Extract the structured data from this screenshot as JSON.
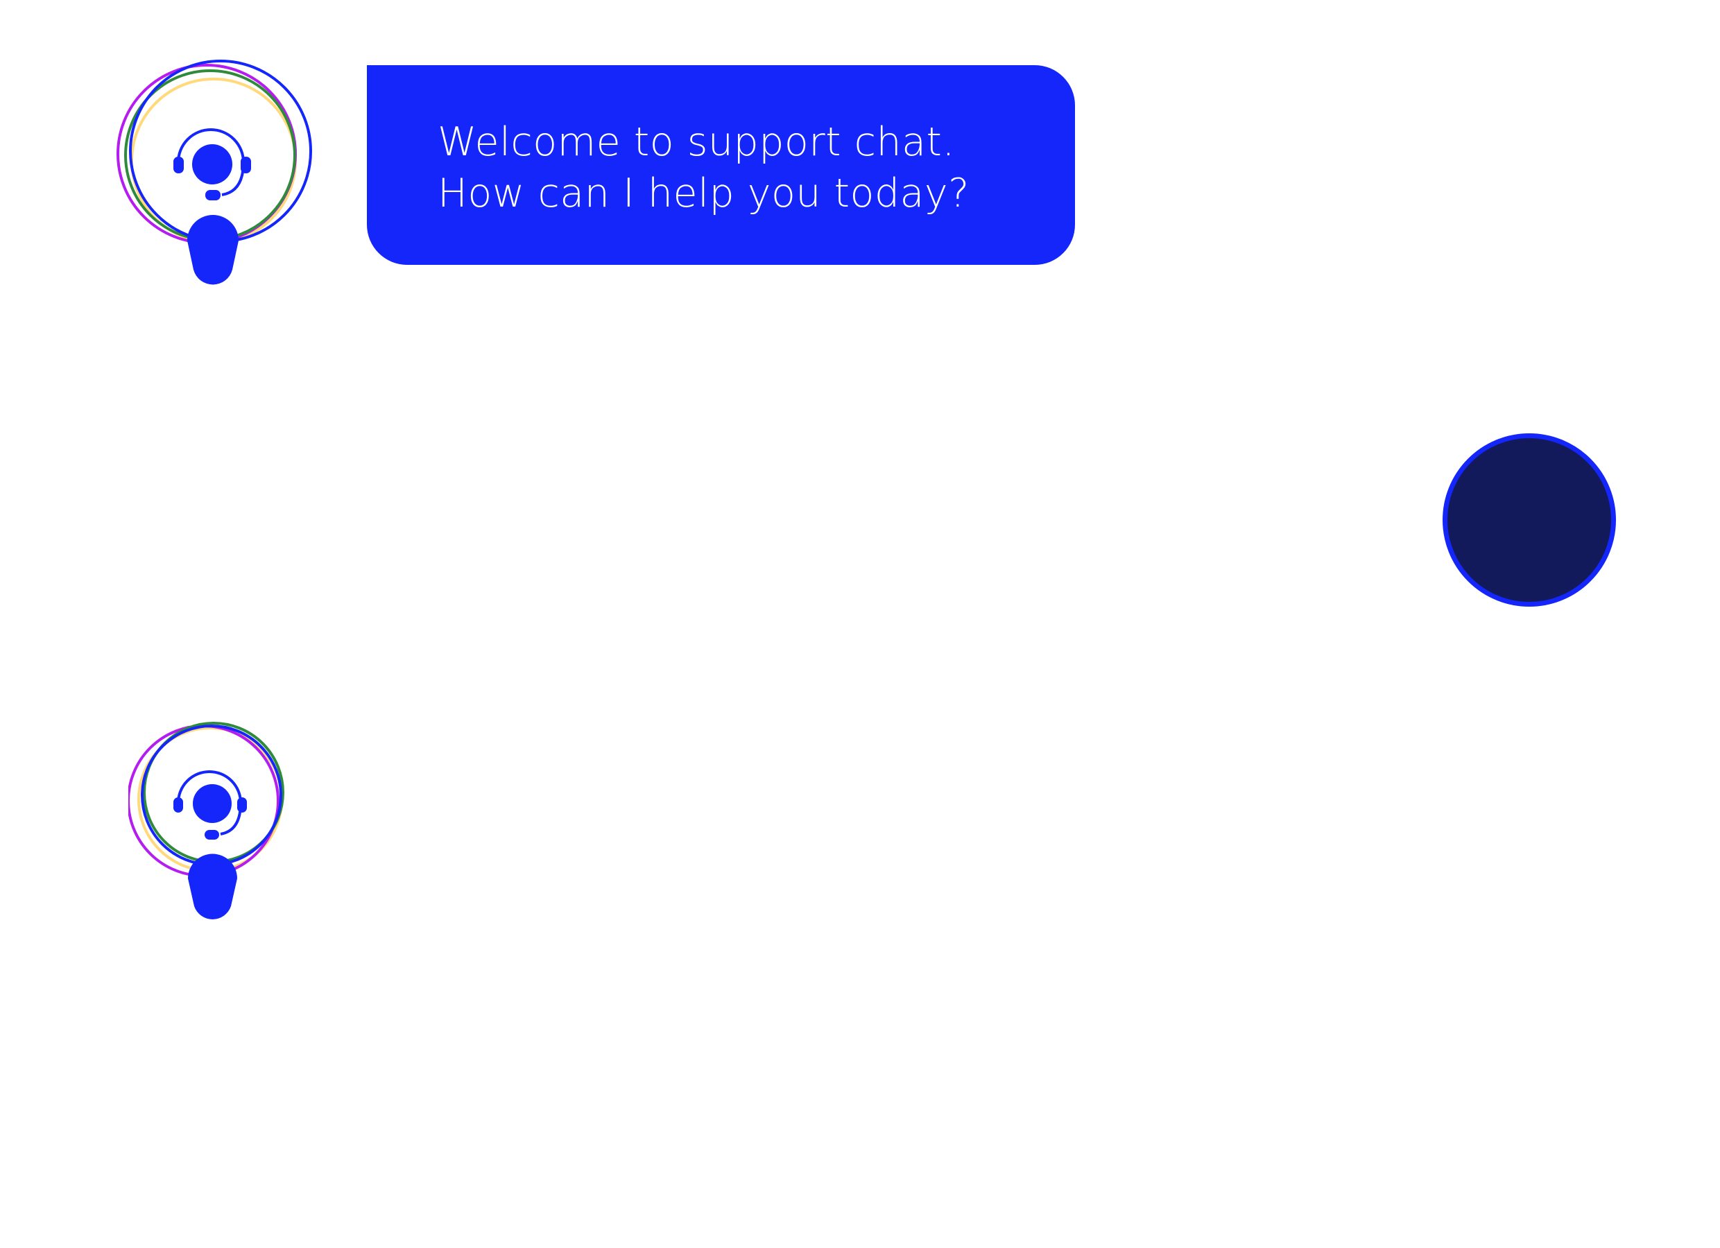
{
  "colors": {
    "brand_blue": "#1426f9",
    "navy": "#131a5c",
    "ring_purple": "#b51cf0",
    "ring_green": "#2f8a3c",
    "ring_yellow": "#ffd97a",
    "background": "#ffffff"
  },
  "messages": [
    {
      "sender": "agent",
      "lines": [
        "Welcome to support chat.",
        "How can I help you today?"
      ]
    }
  ],
  "icons": {
    "agent_avatar": "support-agent-headset-icon",
    "user_avatar": "user-avatar-circle"
  }
}
